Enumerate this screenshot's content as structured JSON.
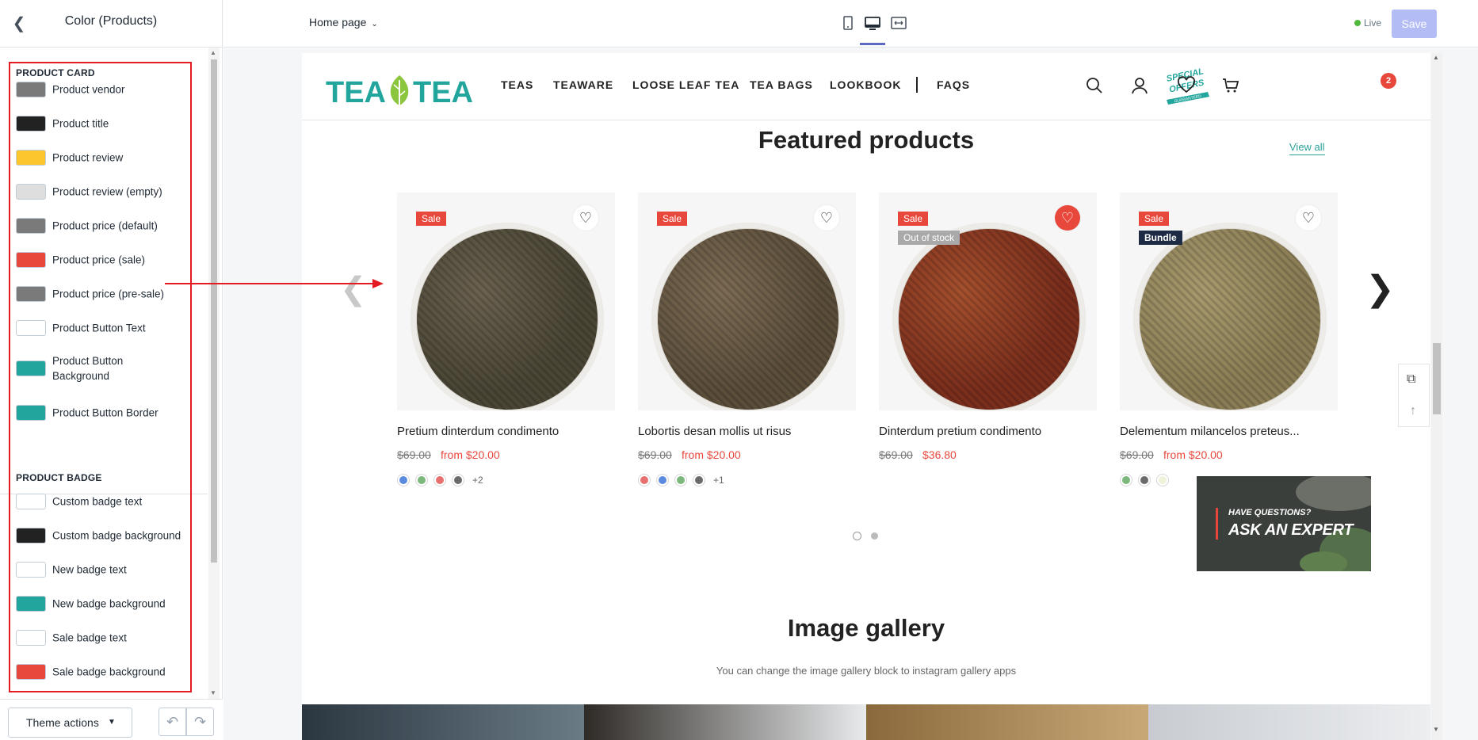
{
  "sidebar": {
    "title": "Color (Products)",
    "back_icon": "chevron-left-icon",
    "sections": [
      {
        "title": "PRODUCT CARD",
        "items": [
          {
            "label": "Product vendor",
            "color": "#7a7a7a"
          },
          {
            "label": "Product title",
            "color": "#222222"
          },
          {
            "label": "Product review",
            "color": "#fcc72c"
          },
          {
            "label": "Product review (empty)",
            "color": "#dedede"
          },
          {
            "label": "Product price (default)",
            "color": "#7a7a7a"
          },
          {
            "label": "Product price (sale)",
            "color": "#e8473c"
          },
          {
            "label": "Product price (pre-sale)",
            "color": "#7a7a7a"
          },
          {
            "label": "Product Button Text",
            "color": "#ffffff"
          },
          {
            "label": "Product Button Background",
            "color": "#22a59c"
          },
          {
            "label": "Product Button Border",
            "color": "#22a59c"
          }
        ]
      },
      {
        "title": "PRODUCT BADGE",
        "items": [
          {
            "label": "Custom badge text",
            "color": "#ffffff"
          },
          {
            "label": "Custom badge background",
            "color": "#222222"
          },
          {
            "label": "New badge text",
            "color": "#ffffff"
          },
          {
            "label": "New badge background",
            "color": "#22a59c"
          },
          {
            "label": "Sale badge text",
            "color": "#ffffff"
          },
          {
            "label": "Sale badge background",
            "color": "#e8473c"
          }
        ]
      }
    ],
    "footer": {
      "theme_actions_label": "Theme actions",
      "undo_icon": "undo-icon",
      "redo_icon": "redo-icon"
    }
  },
  "topbar": {
    "page_selector": "Home page",
    "device_icons": [
      "mobile-icon",
      "desktop-icon",
      "fullwidth-icon"
    ],
    "active_device": "desktop-icon",
    "status_label": "Live",
    "status_color": "#50b83c",
    "save_label": "Save"
  },
  "store": {
    "logo_text": "TEA TEA",
    "brand_color": "#22a59c",
    "nav": [
      "TEAS",
      "TEAWARE",
      "LOOSE LEAF TEA",
      "TEA BAGS",
      "LOOKBOOK",
      "FAQS"
    ],
    "special_offer_text": [
      "SPECIAL",
      "OFFERS",
      "GUARANTEED"
    ],
    "cart_count": "2",
    "header_icons": [
      "search-icon",
      "account-icon",
      "heart-icon",
      "cart-icon"
    ]
  },
  "featured": {
    "title": "Featured products",
    "view_all": "View all",
    "products": [
      {
        "name": "Pretium dinterdum condimento",
        "old_price": "$69.00",
        "price": "from $20.00",
        "badges": [
          {
            "text": "Sale",
            "color": "#e8473c"
          }
        ],
        "wishlisted": false,
        "swatches": [
          "#5b8be0",
          "#7cb87c",
          "#e87070",
          "#6b6b6b"
        ],
        "more": "+2",
        "tea_color": [
          "#4a4535",
          "#6b6250"
        ]
      },
      {
        "name": "Lobortis desan mollis ut risus",
        "old_price": "$69.00",
        "price": "from $20.00",
        "badges": [
          {
            "text": "Sale",
            "color": "#e8473c"
          }
        ],
        "wishlisted": false,
        "swatches": [
          "#e87070",
          "#5b8be0",
          "#7cb87c",
          "#6b6b6b"
        ],
        "more": "+1",
        "tea_color": [
          "#5a4d3a",
          "#7d6c55"
        ]
      },
      {
        "name": "Dinterdum pretium condimento",
        "old_price": "$69.00",
        "price": "$36.80",
        "badges": [
          {
            "text": "Sale",
            "color": "#e8473c"
          },
          {
            "text": "Out of stock",
            "color": "#a9a9a9"
          }
        ],
        "wishlisted": true,
        "swatches": [],
        "more": "",
        "tea_color": [
          "#7a2e1c",
          "#a5502e"
        ]
      },
      {
        "name": "Delementum milancelos preteus...",
        "old_price": "$69.00",
        "price": "from $20.00",
        "badges": [
          {
            "text": "Sale",
            "color": "#e8473c"
          },
          {
            "text": "Bundle",
            "color": "#1d2b45"
          }
        ],
        "wishlisted": false,
        "swatches": [
          "#7cb87c",
          "#6b6b6b",
          "#eef2d8"
        ],
        "more": "",
        "tea_color": [
          "#8a7d55",
          "#a89a6e"
        ]
      }
    ]
  },
  "expert_banner": {
    "question": "HAVE QUESTIONS?",
    "cta": "ASK AN EXPERT"
  },
  "gallery": {
    "title": "Image gallery",
    "subtitle": "You can change the image gallery block to instagram gallery apps"
  }
}
